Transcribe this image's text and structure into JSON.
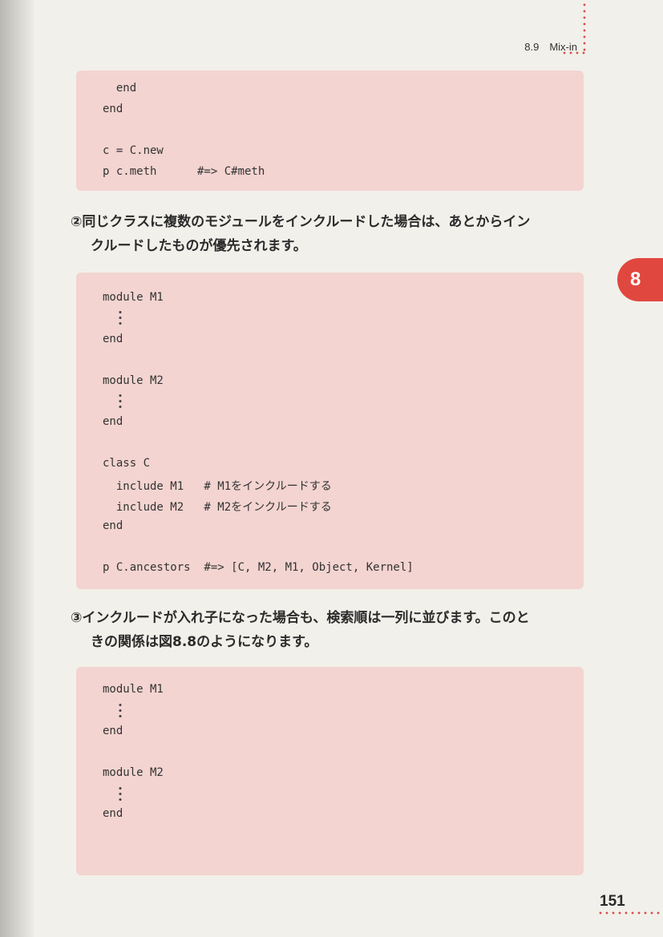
{
  "header": {
    "running_head": "8.9　Mix-in",
    "chapter_tab": "8",
    "page_number": "151"
  },
  "block1": {
    "lines": [
      "  end",
      "end",
      "",
      "c = C.new",
      "p c.meth      #=> C#meth"
    ]
  },
  "para2": {
    "number": "②",
    "line1": "同じクラスに複数のモジュールをインクルードした場合は、あとからイン",
    "line2": "クルードしたものが優先されます。"
  },
  "block2": {
    "lines": [
      "module M1",
      "",
      "end",
      "",
      "module M2",
      "",
      "end",
      "",
      "class C",
      "  include M1   # M1をインクルードする",
      "  include M2   # M2をインクルードする",
      "end",
      "",
      "p C.ancestors  #=> [C, M2, M1, Object, Kernel]"
    ]
  },
  "para3": {
    "number": "③",
    "line1": "インクルードが入れ子になった場合も、検索順は一列に並びます。このと",
    "line2": "きの関係は図8.8のようになります。"
  },
  "block3": {
    "lines": [
      "module M1",
      "",
      "end",
      "",
      "module M2",
      "",
      "end"
    ]
  },
  "colors": {
    "code_bg": "#f3d4d0",
    "accent": "#e0473f"
  }
}
